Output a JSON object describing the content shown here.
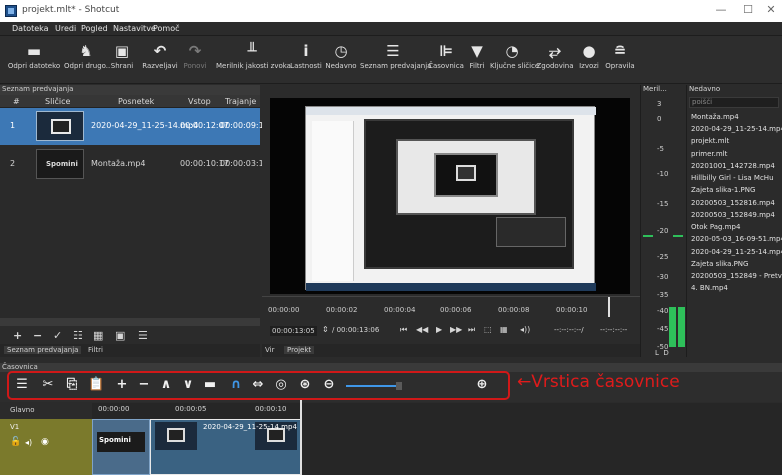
{
  "window": {
    "title": "projekt.mlt* - Shotcut",
    "controls": [
      "—",
      "☐",
      "✕"
    ]
  },
  "menu": [
    "Datoteka",
    "Uredi",
    "Pogled",
    "Nastavitve",
    "Pomoč"
  ],
  "toolbar": [
    {
      "icon": "folder-icon",
      "label": "Odpri datoteko",
      "glyph": "▬"
    },
    {
      "icon": "open-other-icon",
      "label": "Odpri drugo..",
      "glyph": "♞"
    },
    {
      "icon": "save-icon",
      "label": "Shrani",
      "glyph": "▣"
    },
    {
      "icon": "undo-icon",
      "label": "Razveljavi",
      "glyph": "↶"
    },
    {
      "icon": "redo-icon",
      "label": "Ponovi",
      "glyph": "↷",
      "disabled": true
    },
    {
      "icon": "audio-meter-icon",
      "label": "Merilnik jakosti zvoka",
      "glyph": "╨"
    },
    {
      "icon": "properties-icon",
      "label": "Lastnosti",
      "glyph": "i"
    },
    {
      "icon": "recent-icon",
      "label": "Nedavno",
      "glyph": "◷"
    },
    {
      "icon": "playlist-icon",
      "label": "Seznam predvajanja",
      "glyph": "☰"
    },
    {
      "icon": "timeline-icon",
      "label": "Časovnica",
      "glyph": "⊫"
    },
    {
      "icon": "filters-icon",
      "label": "Filtri",
      "glyph": "▼"
    },
    {
      "icon": "keyframes-icon",
      "label": "Ključne sličice",
      "glyph": "◔"
    },
    {
      "icon": "history-icon",
      "label": "Zgodovina",
      "glyph": "⥂"
    },
    {
      "icon": "export-icon",
      "label": "Izvozi",
      "glyph": "●"
    },
    {
      "icon": "jobs-icon",
      "label": "Opravila",
      "glyph": "≘"
    }
  ],
  "playlist": {
    "panel_title": "Seznam predvajanja",
    "columns": [
      "#",
      "Sličice",
      "Posnetek",
      "Vstop",
      "Trajanje"
    ],
    "rows": [
      {
        "num": "1",
        "thumb": "",
        "clip": "2020-04-29_11-25-14.mp4",
        "in": "00:00:12:07",
        "duration": "00:00:09:16",
        "selected": true
      },
      {
        "num": "2",
        "thumb": "Spomini",
        "clip": "Montaža.mp4",
        "in": "00:00:10:17",
        "duration": "00:00:03:15",
        "selected": false
      }
    ],
    "tabs": [
      "Seznam predvajanja",
      "Filtri"
    ]
  },
  "player": {
    "ruler": [
      "00:00:00",
      "00:00:02",
      "00:00:04",
      "00:00:06",
      "00:00:08",
      "00:00:10"
    ],
    "current": "00:00:13:05",
    "total": "/ 00:00:13:06",
    "in_point": "--:--:--:--/",
    "out_point": "--:--:--:--",
    "tabs": [
      "Vir",
      "Projekt"
    ]
  },
  "meter": {
    "title": "Meril...",
    "scale": [
      "3",
      "0",
      "-5",
      "-10",
      "-15",
      "-20",
      "-25",
      "-30",
      "-35",
      "-40",
      "-45",
      "-50"
    ],
    "channels": "L  D"
  },
  "recent": {
    "title": "Nedavno",
    "search_placeholder": "poišči",
    "items": [
      "Montaža.mp4",
      "2020-04-29_11-25-14.mp4",
      "projekt.mlt",
      "primer.mlt",
      "20201001_142728.mp4",
      "Hillbilly Girl - Lisa McHu",
      "Zajeta slika-1.PNG",
      "20200503_152816.mp4",
      "20200503_152849.mp4",
      "Otok Pag.mp4",
      "2020-05-03_16-09-51.mp4",
      "2020-04-29_11-25-14.mp4",
      "Zajeta slika.PNG",
      "20200503_152849 - Pretv",
      "4. BN.mp4"
    ]
  },
  "timeline": {
    "panel_title": "Časovnica",
    "annotation": "←Vrstica časovnice",
    "track_header": "Glavno",
    "track": "V1",
    "ruler": [
      "00:00:00",
      "00:00:05",
      "00:00:10"
    ],
    "clips": [
      {
        "label": "Spomini"
      },
      {
        "label": "2020-04-29_11-25-14.mp4"
      }
    ]
  },
  "colors": {
    "selection": "#3d78b5",
    "annotation": "#e01b1b",
    "meter_green": "#2ec05a"
  }
}
